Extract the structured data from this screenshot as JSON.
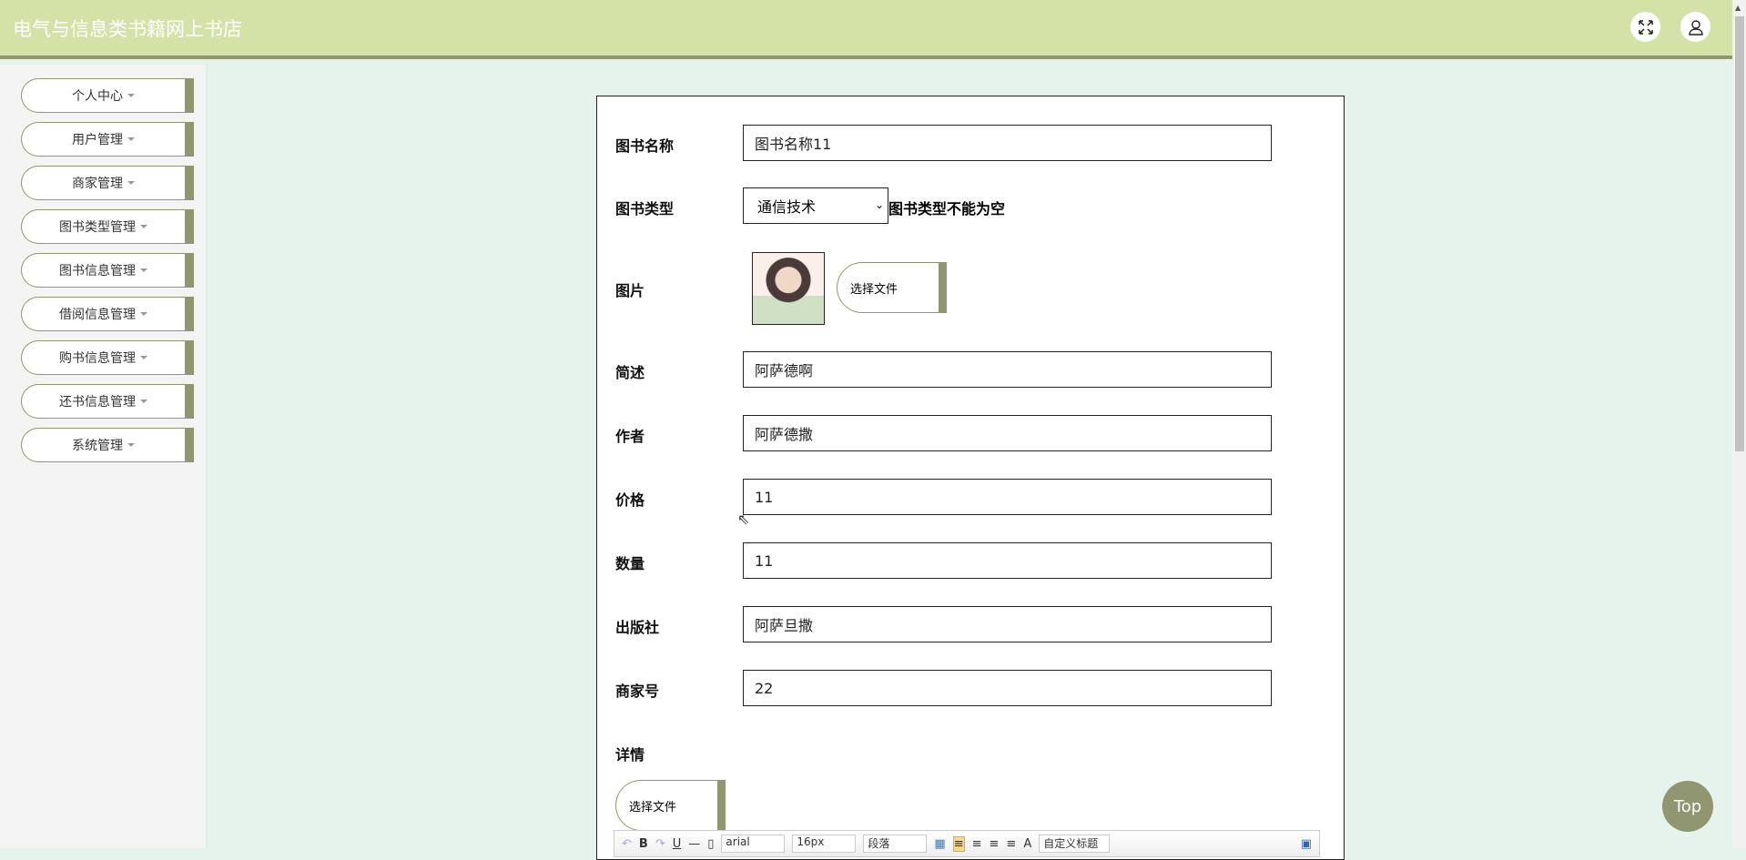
{
  "header": {
    "title": "电气与信息类书籍网上书店",
    "fullscreen_icon": "expand-icon",
    "user_icon": "user-icon"
  },
  "sidebar": {
    "items": [
      {
        "label": "个人中心"
      },
      {
        "label": "用户管理"
      },
      {
        "label": "商家管理"
      },
      {
        "label": "图书类型管理"
      },
      {
        "label": "图书信息管理"
      },
      {
        "label": "借阅信息管理"
      },
      {
        "label": "购书信息管理"
      },
      {
        "label": "还书信息管理"
      },
      {
        "label": "系统管理"
      }
    ]
  },
  "form": {
    "name": {
      "label": "图书名称",
      "value": "图书名称11"
    },
    "type": {
      "label": "图书类型",
      "value": "通信技术",
      "error": "图书类型不能为空"
    },
    "image": {
      "label": "图片",
      "button": "选择文件"
    },
    "summary": {
      "label": "简述",
      "value": "阿萨德啊"
    },
    "author": {
      "label": "作者",
      "value": "阿萨德撒"
    },
    "price": {
      "label": "价格",
      "value": "11"
    },
    "quantity": {
      "label": "数量",
      "value": "11"
    },
    "publisher": {
      "label": "出版社",
      "value": "阿萨旦撒"
    },
    "merchant": {
      "label": "商家号",
      "value": "22"
    },
    "detail": {
      "label": "详情",
      "button": "选择文件"
    }
  },
  "editor": {
    "font": "arial",
    "size": "16px",
    "paragraph": "段落",
    "custom_title": "自定义标题",
    "bold": "B",
    "underline": "U",
    "font_color": "A"
  },
  "top_button": "Top",
  "colors": {
    "accent": "#8f9670",
    "header": "#d4e2a8",
    "background": "#e6f3ed"
  }
}
